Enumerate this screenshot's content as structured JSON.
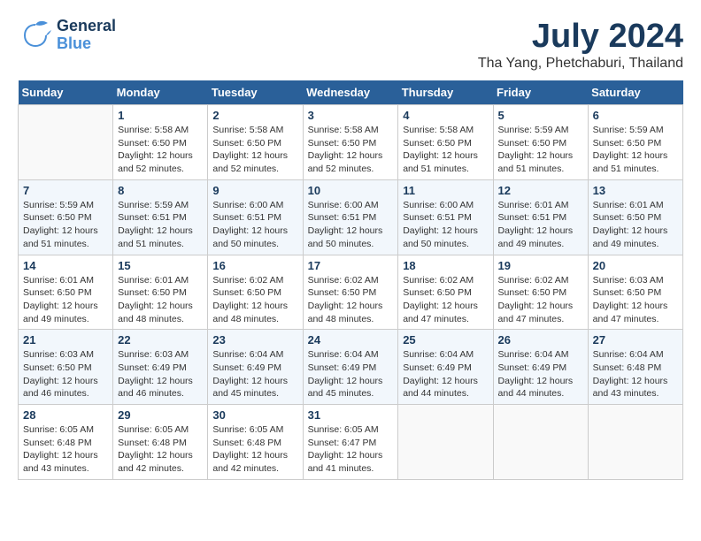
{
  "header": {
    "logo_general": "General",
    "logo_blue": "Blue",
    "month_year": "July 2024",
    "location": "Tha Yang, Phetchaburi, Thailand"
  },
  "columns": [
    "Sunday",
    "Monday",
    "Tuesday",
    "Wednesday",
    "Thursday",
    "Friday",
    "Saturday"
  ],
  "weeks": [
    {
      "days": [
        {
          "num": "",
          "info": ""
        },
        {
          "num": "1",
          "info": "Sunrise: 5:58 AM\nSunset: 6:50 PM\nDaylight: 12 hours\nand 52 minutes."
        },
        {
          "num": "2",
          "info": "Sunrise: 5:58 AM\nSunset: 6:50 PM\nDaylight: 12 hours\nand 52 minutes."
        },
        {
          "num": "3",
          "info": "Sunrise: 5:58 AM\nSunset: 6:50 PM\nDaylight: 12 hours\nand 52 minutes."
        },
        {
          "num": "4",
          "info": "Sunrise: 5:58 AM\nSunset: 6:50 PM\nDaylight: 12 hours\nand 51 minutes."
        },
        {
          "num": "5",
          "info": "Sunrise: 5:59 AM\nSunset: 6:50 PM\nDaylight: 12 hours\nand 51 minutes."
        },
        {
          "num": "6",
          "info": "Sunrise: 5:59 AM\nSunset: 6:50 PM\nDaylight: 12 hours\nand 51 minutes."
        }
      ]
    },
    {
      "days": [
        {
          "num": "7",
          "info": "Sunrise: 5:59 AM\nSunset: 6:50 PM\nDaylight: 12 hours\nand 51 minutes."
        },
        {
          "num": "8",
          "info": "Sunrise: 5:59 AM\nSunset: 6:51 PM\nDaylight: 12 hours\nand 51 minutes."
        },
        {
          "num": "9",
          "info": "Sunrise: 6:00 AM\nSunset: 6:51 PM\nDaylight: 12 hours\nand 50 minutes."
        },
        {
          "num": "10",
          "info": "Sunrise: 6:00 AM\nSunset: 6:51 PM\nDaylight: 12 hours\nand 50 minutes."
        },
        {
          "num": "11",
          "info": "Sunrise: 6:00 AM\nSunset: 6:51 PM\nDaylight: 12 hours\nand 50 minutes."
        },
        {
          "num": "12",
          "info": "Sunrise: 6:01 AM\nSunset: 6:51 PM\nDaylight: 12 hours\nand 49 minutes."
        },
        {
          "num": "13",
          "info": "Sunrise: 6:01 AM\nSunset: 6:50 PM\nDaylight: 12 hours\nand 49 minutes."
        }
      ]
    },
    {
      "days": [
        {
          "num": "14",
          "info": "Sunrise: 6:01 AM\nSunset: 6:50 PM\nDaylight: 12 hours\nand 49 minutes."
        },
        {
          "num": "15",
          "info": "Sunrise: 6:01 AM\nSunset: 6:50 PM\nDaylight: 12 hours\nand 48 minutes."
        },
        {
          "num": "16",
          "info": "Sunrise: 6:02 AM\nSunset: 6:50 PM\nDaylight: 12 hours\nand 48 minutes."
        },
        {
          "num": "17",
          "info": "Sunrise: 6:02 AM\nSunset: 6:50 PM\nDaylight: 12 hours\nand 48 minutes."
        },
        {
          "num": "18",
          "info": "Sunrise: 6:02 AM\nSunset: 6:50 PM\nDaylight: 12 hours\nand 47 minutes."
        },
        {
          "num": "19",
          "info": "Sunrise: 6:02 AM\nSunset: 6:50 PM\nDaylight: 12 hours\nand 47 minutes."
        },
        {
          "num": "20",
          "info": "Sunrise: 6:03 AM\nSunset: 6:50 PM\nDaylight: 12 hours\nand 47 minutes."
        }
      ]
    },
    {
      "days": [
        {
          "num": "21",
          "info": "Sunrise: 6:03 AM\nSunset: 6:50 PM\nDaylight: 12 hours\nand 46 minutes."
        },
        {
          "num": "22",
          "info": "Sunrise: 6:03 AM\nSunset: 6:49 PM\nDaylight: 12 hours\nand 46 minutes."
        },
        {
          "num": "23",
          "info": "Sunrise: 6:04 AM\nSunset: 6:49 PM\nDaylight: 12 hours\nand 45 minutes."
        },
        {
          "num": "24",
          "info": "Sunrise: 6:04 AM\nSunset: 6:49 PM\nDaylight: 12 hours\nand 45 minutes."
        },
        {
          "num": "25",
          "info": "Sunrise: 6:04 AM\nSunset: 6:49 PM\nDaylight: 12 hours\nand 44 minutes."
        },
        {
          "num": "26",
          "info": "Sunrise: 6:04 AM\nSunset: 6:49 PM\nDaylight: 12 hours\nand 44 minutes."
        },
        {
          "num": "27",
          "info": "Sunrise: 6:04 AM\nSunset: 6:48 PM\nDaylight: 12 hours\nand 43 minutes."
        }
      ]
    },
    {
      "days": [
        {
          "num": "28",
          "info": "Sunrise: 6:05 AM\nSunset: 6:48 PM\nDaylight: 12 hours\nand 43 minutes."
        },
        {
          "num": "29",
          "info": "Sunrise: 6:05 AM\nSunset: 6:48 PM\nDaylight: 12 hours\nand 42 minutes."
        },
        {
          "num": "30",
          "info": "Sunrise: 6:05 AM\nSunset: 6:48 PM\nDaylight: 12 hours\nand 42 minutes."
        },
        {
          "num": "31",
          "info": "Sunrise: 6:05 AM\nSunset: 6:47 PM\nDaylight: 12 hours\nand 41 minutes."
        },
        {
          "num": "",
          "info": ""
        },
        {
          "num": "",
          "info": ""
        },
        {
          "num": "",
          "info": ""
        }
      ]
    }
  ]
}
